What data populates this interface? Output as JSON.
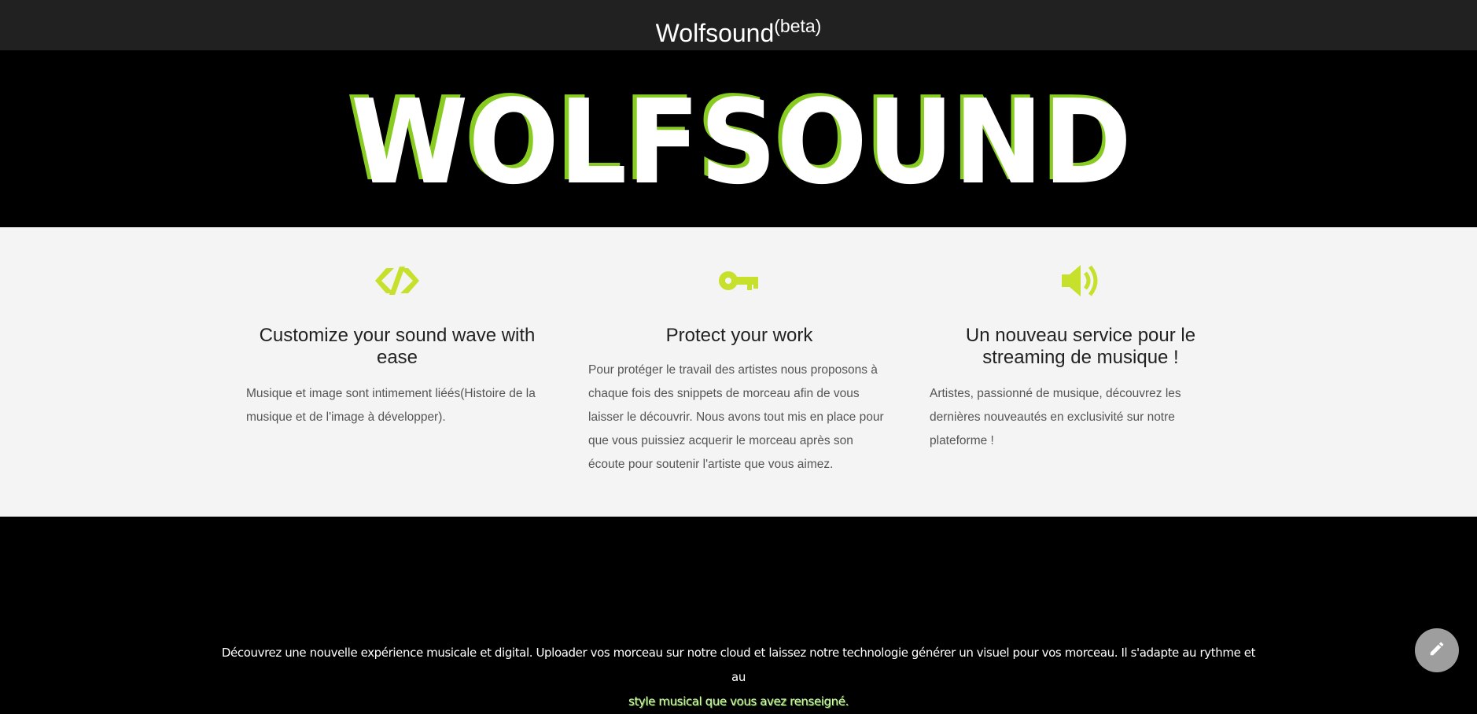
{
  "header": {
    "brand": "Wolfsound",
    "brand_sup": "(beta)"
  },
  "hero": {
    "logo_text": "WOLFSOUND"
  },
  "features": [
    {
      "icon": "code-brackets-icon",
      "title": "Customize your sound wave with ease",
      "text": "Musique et image sont intimement liéés(Histoire de la musique et de l'image à développer)."
    },
    {
      "icon": "key-icon",
      "title": "Protect your work",
      "text": "Pour protéger le travail des artistes nous proposons à chaque fois des snippets de morceau afin de vous laisser le découvrir. Nous avons tout mis en place pour que vous puissiez acquerir le morceau après son écoute pour soutenir l'artiste que vous aimez."
    },
    {
      "icon": "speaker-icon",
      "title": "Un nouveau service pour le streaming de musique !",
      "text": "Artistes, passionné de musique, découvrez les dernières nouveautés en exclusivité sur notre plateforme !"
    }
  ],
  "footer": {
    "description": "Découvrez une nouvelle expérience musicale et digital. Uploader vos morceau sur notre cloud et laissez notre technologie générer un visuel pour vos morceau. Il s'adapte au rythme et au",
    "description_end": "style musical que vous avez renseigné."
  },
  "fab": {
    "icon": "pencil-icon"
  },
  "colors": {
    "accent": "#c6e02c",
    "topbar": "#212121",
    "features_bg": "#f4f4f4",
    "fab": "#9e9e9e"
  }
}
